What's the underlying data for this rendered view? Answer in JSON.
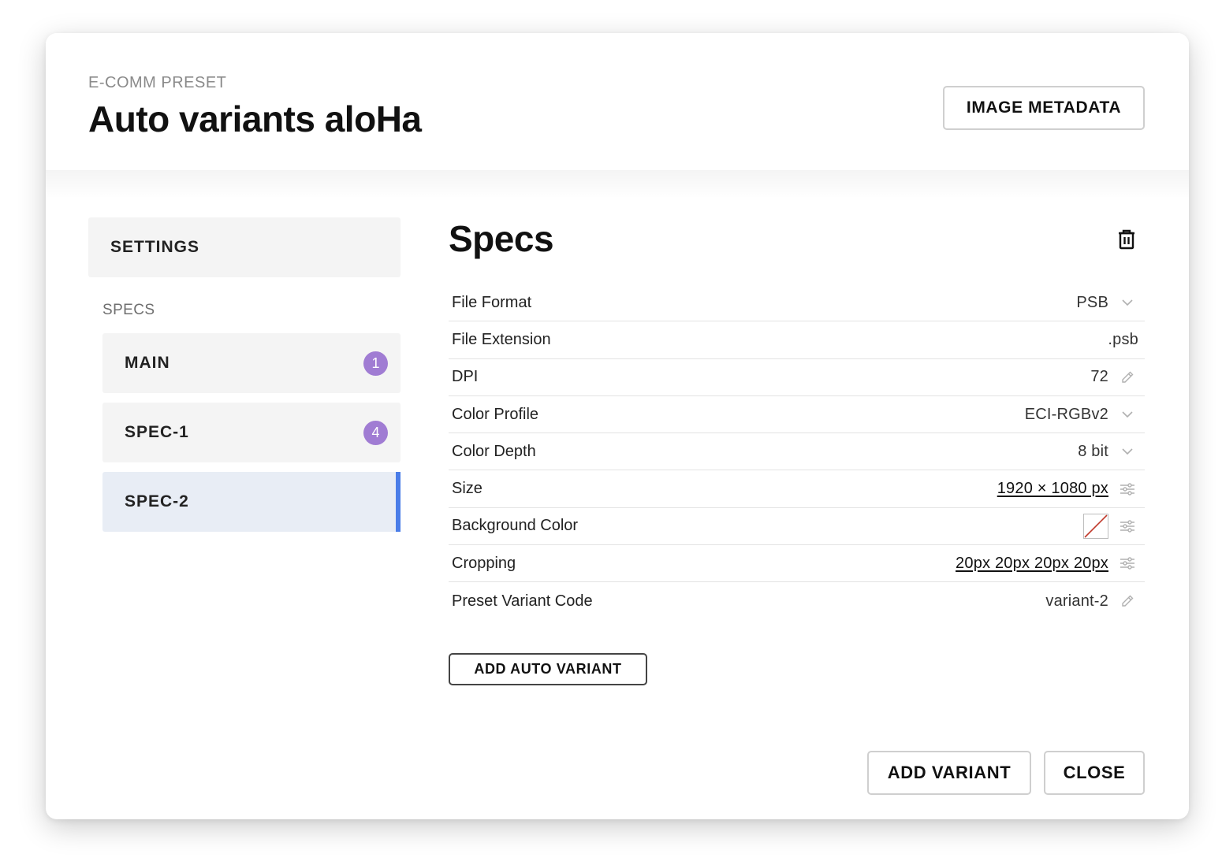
{
  "header": {
    "eyebrow": "E-COMM PRESET",
    "title": "Auto variants aloHa",
    "metadata_button": "IMAGE METADATA"
  },
  "sidebar": {
    "settings_label": "SETTINGS",
    "specs_label": "SPECS",
    "items": [
      {
        "label": "MAIN",
        "badge": "1"
      },
      {
        "label": "SPEC-1",
        "badge": "4"
      },
      {
        "label": "SPEC-2",
        "badge": ""
      }
    ]
  },
  "main": {
    "section_title": "Specs",
    "rows": [
      {
        "label": "File Format",
        "value": "PSB",
        "icon": "chevron-down-icon"
      },
      {
        "label": "File Extension",
        "value": ".psb",
        "icon": ""
      },
      {
        "label": "DPI",
        "value": "72",
        "icon": "pencil-icon"
      },
      {
        "label": "Color Profile",
        "value": "ECI-RGBv2",
        "icon": "chevron-down-icon"
      },
      {
        "label": "Color Depth",
        "value": "8 bit",
        "icon": "chevron-down-icon"
      },
      {
        "label": "Size",
        "value": "1920 × 1080 px",
        "icon": "sliders-icon"
      },
      {
        "label": "Background Color",
        "value": "",
        "icon": "sliders-icon"
      },
      {
        "label": "Cropping",
        "value": "20px 20px 20px 20px",
        "icon": "sliders-icon"
      },
      {
        "label": "Preset Variant Code",
        "value": "variant-2",
        "icon": "pencil-icon"
      }
    ],
    "add_auto_variant_button": "ADD AUTO VARIANT"
  },
  "footer": {
    "add_variant_button": "ADD VARIANT",
    "close_button": "CLOSE"
  },
  "colors": {
    "badge": "#a07cd3",
    "active_item_bg": "#e8edf5",
    "active_indicator": "#4a7de8",
    "swatch_strike": "#c0392b"
  },
  "icons": [
    "trash-icon",
    "chevron-down-icon",
    "pencil-icon",
    "sliders-icon"
  ]
}
